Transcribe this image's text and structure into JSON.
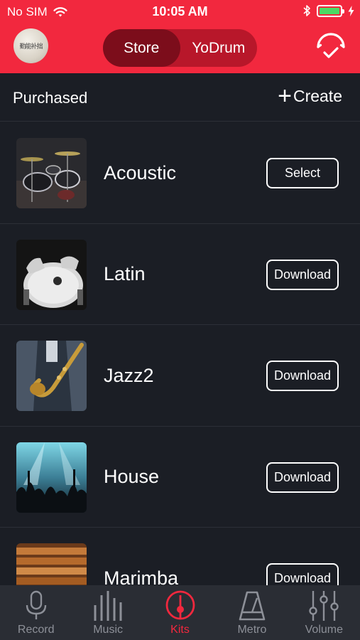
{
  "status_bar": {
    "carrier": "No SIM",
    "time": "10:05 AM",
    "battery_level": 1.0,
    "icons": [
      "wifi-icon",
      "bluetooth-icon",
      "battery-icon",
      "charging-icon"
    ]
  },
  "nav": {
    "segments": [
      "Store",
      "YoDrum"
    ],
    "active_segment": "Store",
    "avatar_text": "勤能补拙",
    "right_icon": "sync-check-icon"
  },
  "subheader": {
    "title": "Purchased",
    "create_label": "Create"
  },
  "kits": [
    {
      "name": "Acoustic",
      "action": "Select"
    },
    {
      "name": "Latin",
      "action": "Download"
    },
    {
      "name": "Jazz2",
      "action": "Download"
    },
    {
      "name": "House",
      "action": "Download"
    },
    {
      "name": "Marimba",
      "action": "Download"
    }
  ],
  "tabs": [
    {
      "label": "Record",
      "icon": "microphone-icon"
    },
    {
      "label": "Music",
      "icon": "equalizer-bars-icon"
    },
    {
      "label": "Kits",
      "icon": "drumstick-circle-icon"
    },
    {
      "label": "Metro",
      "icon": "metronome-icon"
    },
    {
      "label": "Volume",
      "icon": "sliders-icon"
    }
  ],
  "active_tab": "Kits",
  "colors": {
    "accent": "#f2283e",
    "background": "#1b1e25",
    "tabbar": "#2a2d34",
    "tab_inactive": "#8d9098",
    "segment_active": "#7c0d1b"
  }
}
